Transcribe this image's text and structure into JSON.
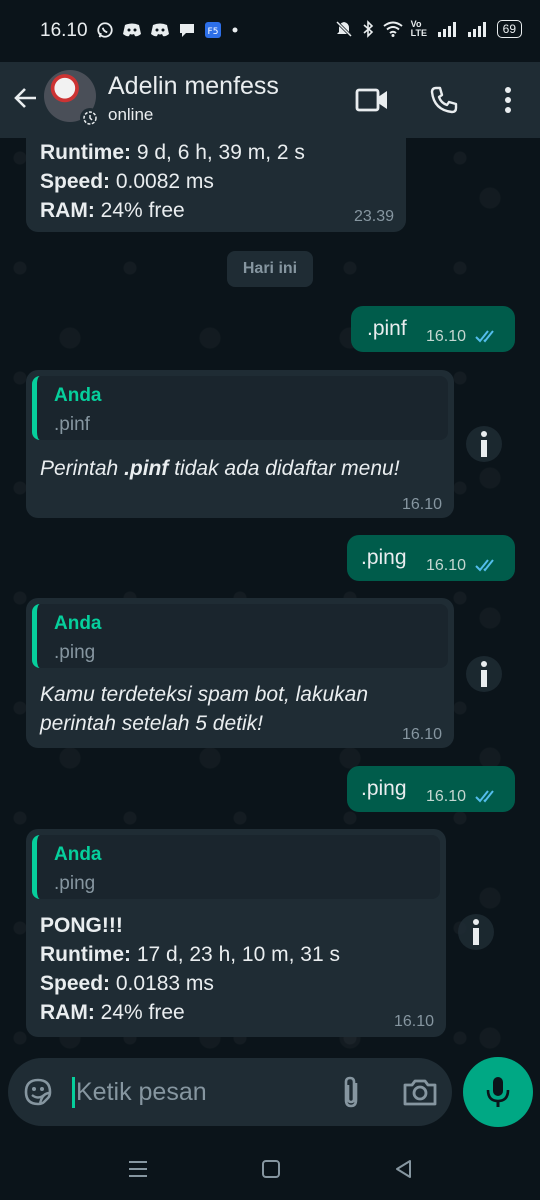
{
  "status_bar": {
    "time": "16.10",
    "battery": "69",
    "network_label": "Vo LTE"
  },
  "header": {
    "contact_name": "Adelin menfess",
    "contact_status": "online"
  },
  "chat": {
    "date_chip": "Hari ini",
    "first_message_tail": {
      "lines": [
        {
          "label": "Runtime:",
          "value": " 9 d, 6 h, 39 m, 2 s"
        },
        {
          "label": "Speed:",
          "value": " 0.0082 ms"
        },
        {
          "label": "RAM:",
          "value": " 24% free"
        }
      ],
      "time": "23.39"
    },
    "messages": [
      {
        "direction": "out",
        "text": ".pinf",
        "time": "16.10",
        "status": "read"
      },
      {
        "direction": "in",
        "quote_author": "Anda",
        "quote_text": ".pinf",
        "text_pre": "Perintah ",
        "text_bold": ".pinf",
        "text_post": " tidak ada didaftar menu!",
        "time": "16.10"
      },
      {
        "direction": "out",
        "text": ".ping",
        "time": "16.10",
        "status": "read"
      },
      {
        "direction": "in",
        "quote_author": "Anda",
        "quote_text": ".ping",
        "text_line1": "Kamu terdeteksi spam bot, lakukan",
        "text_line2": "perintah setelah 5 detik!",
        "time": "16.10"
      },
      {
        "direction": "out",
        "text": ".ping",
        "time": "16.10",
        "status": "read"
      },
      {
        "direction": "in",
        "quote_author": "Anda",
        "quote_text": ".ping",
        "lines": [
          {
            "label": "PONG!!!",
            "value": ""
          },
          {
            "label": "Runtime:",
            "value": " 17 d, 23 h, 10 m, 31 s"
          },
          {
            "label": "Speed:",
            "value": " 0.0183 ms"
          },
          {
            "label": "RAM:",
            "value": " 24% free"
          }
        ],
        "time": "16.10"
      }
    ]
  },
  "composer": {
    "placeholder": "Ketik pesan"
  },
  "colors": {
    "background": "#0b141a",
    "incoming_bubble": "#1f2c34",
    "outgoing_bubble": "#005c4b",
    "accent": "#00a884",
    "read_ticks": "#53bdeb"
  }
}
